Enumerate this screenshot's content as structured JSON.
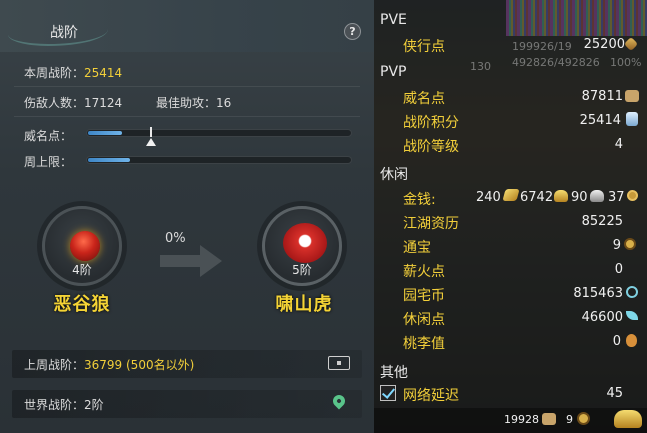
{
  "left": {
    "title": "战阶",
    "help": "?",
    "weekly_label": "本周战阶：",
    "weekly_value": "25414",
    "injured_label": "伤敌人数：",
    "injured_value": "17124",
    "assist_label": "最佳助攻：",
    "assist_value": "16",
    "fame_label": "威名点：",
    "fame_progress": 0.13,
    "weekly_cap_label": "周上限：",
    "weekly_cap_progress": 0.16,
    "current_rank": {
      "level": "4阶",
      "name": "恶谷狼"
    },
    "progress_percent": "0%",
    "next_rank": {
      "level": "5阶",
      "name": "啸山虎"
    },
    "last_week_label": "上周战阶：",
    "last_week_value": "36799 (500名以外)",
    "world_label": "世界战阶：",
    "world_value": "2阶"
  },
  "right": {
    "bg_text": {
      "hp1": "199926/19",
      "hp2": "492826/492826",
      "pct": "100%",
      "lvl": "130"
    },
    "pve": {
      "header": "PVE",
      "items": [
        {
          "label": "侠行点",
          "value": "25200",
          "icon": "pen-icon"
        }
      ]
    },
    "pvp": {
      "header": "PVP",
      "items": [
        {
          "label": "威名点",
          "value": "87811",
          "icon": "mask-icon"
        },
        {
          "label": "战阶积分",
          "value": "25414",
          "icon": "crystal-icon"
        },
        {
          "label": "战阶等级",
          "value": "4",
          "icon": ""
        }
      ]
    },
    "leisure": {
      "header": "休闲",
      "money_label": "金钱:",
      "money": [
        {
          "value": "240",
          "icon": "gold-brick-icon"
        },
        {
          "value": "6742",
          "icon": "gold-ingot-icon"
        },
        {
          "value": "90",
          "icon": "silver-ingot-icon"
        },
        {
          "value": "37",
          "icon": "copper-coin-icon"
        }
      ],
      "items": [
        {
          "label": "江湖资历",
          "value": "85225",
          "icon": ""
        },
        {
          "label": "通宝",
          "value": "9",
          "icon": "coin-icon"
        },
        {
          "label": "薪火点",
          "value": "0",
          "icon": ""
        },
        {
          "label": "园宅币",
          "value": "815463",
          "icon": "swirl-coin-icon"
        },
        {
          "label": "休闲点",
          "value": "46600",
          "icon": "leaf-icon"
        },
        {
          "label": "桃李值",
          "value": "0",
          "icon": "gourd-icon"
        }
      ]
    },
    "other": {
      "header": "其他",
      "latency_label": "网络延迟",
      "latency_value": "45"
    },
    "bottom": {
      "value1": "19928",
      "value2": "9"
    }
  },
  "colors": {
    "accent_gold": "#f2cf3a",
    "bar_blue": "#4a93d0",
    "panel_bg": "#2f373c"
  }
}
